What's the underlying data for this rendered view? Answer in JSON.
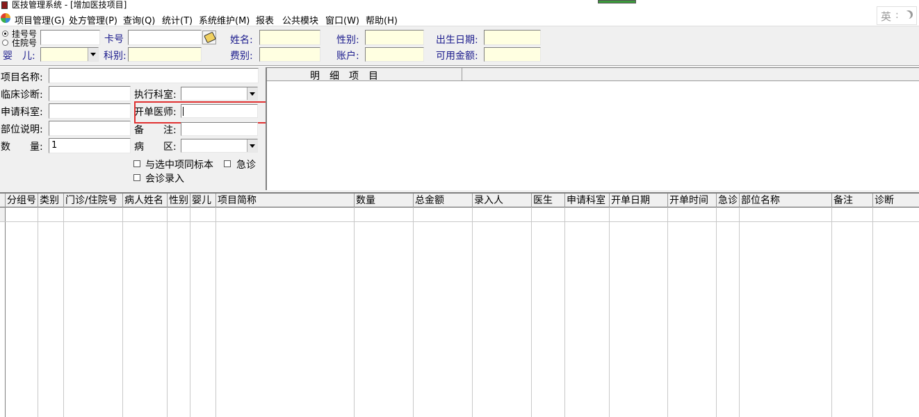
{
  "window": {
    "title": "医技管理系统 - [增加医技项目]"
  },
  "menubar": [
    "项目管理(G)",
    "处方管理(P)",
    "查询(Q)",
    "统计(T)",
    "系统维护(M)",
    "报表",
    "公共模块",
    "窗口(W)",
    "帮助(H)"
  ],
  "ime": {
    "label": "英"
  },
  "patient": {
    "radio_registration": "挂号号",
    "radio_inpatient": "住院号",
    "card_label": "卡号",
    "name_label": "姓名:",
    "gender_label": "性别:",
    "birthdate_label": "出生日期:",
    "infant_label": "婴　儿:",
    "department_label": "科别:",
    "fee_type_label": "费别:",
    "account_label": "账户:",
    "available_amount_label": "可用金额:"
  },
  "form": {
    "item_name_label": "项目名称:",
    "clinical_diagnosis_label": "临床诊断:",
    "exec_dept_label": "执行科室:",
    "apply_dept_label": "申请科室:",
    "ordering_doctor_label": "开单医师:",
    "body_part_label": "部位说明:",
    "remark_label": "备　　注:",
    "quantity_label": "数　　量:",
    "quantity_value": "1",
    "ward_label": "病　　区:",
    "same_specimen_label": "与选中项同标本",
    "urgent_label": "急诊",
    "consult_label": "会诊录入"
  },
  "detail_panel": {
    "title": "明　细　项　目"
  },
  "grid": {
    "columns": [
      "分组号",
      "类别",
      "门诊/住院号",
      "病人姓名",
      "性别",
      "婴儿",
      "项目简称",
      "数量",
      "总金额",
      "录入人",
      "医生",
      "申请科室",
      "开单日期",
      "开单时间",
      "急诊",
      "部位名称",
      "备注",
      "诊断"
    ]
  },
  "colors": {
    "highlight_box": "#e03030",
    "readonly_field": "#ffffe1",
    "label_blue": "#1a1a8c"
  }
}
